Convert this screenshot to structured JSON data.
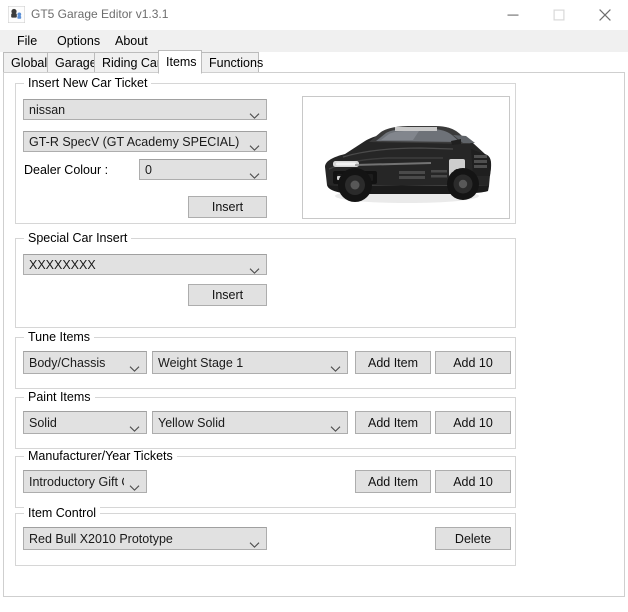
{
  "window": {
    "title": "GT5 Garage Editor v1.3.1",
    "icon": "app-icon",
    "controls": {
      "minimize": "minimize-icon",
      "maximize": "maximize-icon",
      "close": "close-icon"
    }
  },
  "menu": {
    "items": [
      {
        "label": "File"
      },
      {
        "label": "Options"
      },
      {
        "label": "About"
      }
    ]
  },
  "tabs": {
    "selected": "Items",
    "items": [
      {
        "label": "Global"
      },
      {
        "label": "Garage"
      },
      {
        "label": "Riding Car"
      },
      {
        "label": "Items"
      },
      {
        "label": "Functions"
      }
    ]
  },
  "insert_new_car_ticket": {
    "title": "Insert New Car Ticket",
    "manufacturer": {
      "value": "nissan"
    },
    "model": {
      "value": "GT-R SpecV (GT Academy SPECIAL)"
    },
    "dealer_colour_label": "Dealer Colour :",
    "dealer_colour": {
      "value": "0"
    },
    "insert_button": "Insert",
    "preview": {
      "alt": "nissan-gtr-specv-preview"
    }
  },
  "special_car_insert": {
    "title": "Special Car Insert",
    "car": {
      "value": "XXXXXXXX"
    },
    "insert_button": "Insert"
  },
  "tune_items": {
    "title": "Tune Items",
    "category": {
      "value": "Body/Chassis"
    },
    "item": {
      "value": "Weight Stage 1"
    },
    "add_item_button": "Add Item",
    "add_ten_button": "Add 10"
  },
  "paint_items": {
    "title": "Paint Items",
    "category": {
      "value": "Solid"
    },
    "item": {
      "value": "Yellow Solid"
    },
    "add_item_button": "Add Item",
    "add_ten_button": "Add 10"
  },
  "manufacturer_year_tickets": {
    "title": "Manufacturer/Year Tickets",
    "ticket": {
      "value": "Introductory Gift Car"
    },
    "add_item_button": "Add Item",
    "add_ten_button": "Add 10"
  },
  "item_control": {
    "title": "Item Control",
    "item": {
      "value": "Red Bull X2010 Prototype"
    },
    "delete_button": "Delete"
  },
  "colors": {
    "window_bg": "#ffffff",
    "menu_bg": "#f0f0f0",
    "control_face": "#e1e1e1",
    "control_border": "#adadad",
    "group_border": "#d6d6d6",
    "title_text": "#6d6d6d"
  }
}
